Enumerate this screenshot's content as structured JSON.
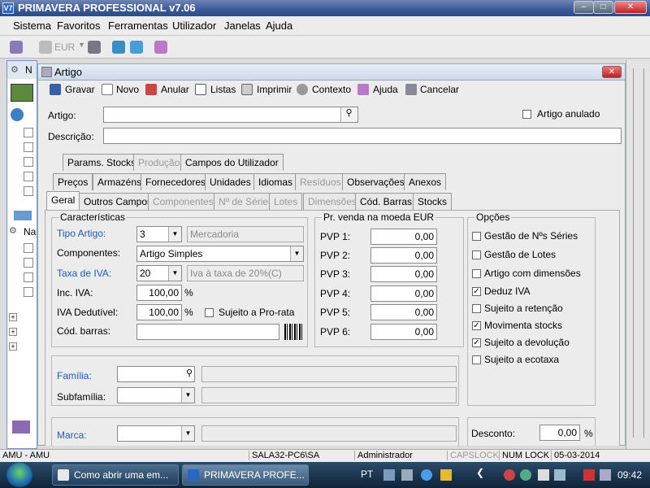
{
  "app": {
    "title": "PRIMAVERA PROFESSIONAL v7.06",
    "logo": "V7"
  },
  "menu": [
    "Sistema",
    "Favoritos",
    "Ferramentas",
    "Utilizador",
    "Janelas",
    "Ajuda"
  ],
  "toolbar": {
    "currency": "EUR"
  },
  "leftpane": {
    "item1": "N",
    "item2": "Na"
  },
  "window": {
    "title": "Artigo",
    "actions": [
      "Gravar",
      "Novo",
      "Anular",
      "Listas",
      "Imprimir",
      "Contexto",
      "Ajuda",
      "Cancelar"
    ],
    "artigo_label": "Artigo:",
    "descricao_label": "Descrição:",
    "artigo_anulado": "Artigo anulado",
    "tabs_row1": [
      "Params. Stocks",
      "Produção",
      "Campos do Utilizador"
    ],
    "tabs_row2": [
      "Preços",
      "Armazéns",
      "Fornecedores",
      "Unidades",
      "Idiomas",
      "Resíduos",
      "Observações",
      "Anexos"
    ],
    "tabs_row3": [
      "Geral",
      "Outros Campos",
      "Componentes",
      "Nº de Série",
      "Lotes",
      "Dimensões",
      "Cód. Barras",
      "Stocks"
    ],
    "caracteristicas": {
      "title": "Características",
      "tipo_label": "Tipo Artigo:",
      "tipo_value": "3",
      "tipo_desc": "Mercadoria",
      "componentes_label": "Componentes:",
      "componentes_value": "Artigo Simples",
      "iva_label": "Taxa de IVA:",
      "iva_value": "20",
      "iva_desc": "Iva à taxa de 20%(C)",
      "inc_iva_label": "Inc. IVA:",
      "inc_iva_value": "100,00",
      "pct": "%",
      "iva_ded_label": "IVA Dedutível:",
      "iva_ded_value": "100,00",
      "prorata_label": "Sujeito a Pro-rata",
      "codbarras_label": "Cód. barras:"
    },
    "pvp": {
      "title": "Pr. venda na moeda EUR",
      "rows": [
        {
          "label": "PVP 1:",
          "value": "0,00"
        },
        {
          "label": "PVP 2:",
          "value": "0,00"
        },
        {
          "label": "PVP 3:",
          "value": "0,00"
        },
        {
          "label": "PVP 4:",
          "value": "0,00"
        },
        {
          "label": "PVP 5:",
          "value": "0,00"
        },
        {
          "label": "PVP 6:",
          "value": "0,00"
        }
      ]
    },
    "opcoes": {
      "title": "Opções",
      "items": [
        {
          "label": "Gestão de Nºs Séries",
          "checked": false
        },
        {
          "label": "Gestão de Lotes",
          "checked": false
        },
        {
          "label": "Artigo com dimensões",
          "checked": false
        },
        {
          "label": "Deduz IVA",
          "checked": true
        },
        {
          "label": "Sujeito a retenção",
          "checked": false
        },
        {
          "label": "Movimenta stocks",
          "checked": true
        },
        {
          "label": "Sujeito a devolução",
          "checked": true
        },
        {
          "label": "Sujeito a ecotaxa",
          "checked": false
        }
      ]
    },
    "familia_label": "Família:",
    "subfamilia_label": "Subfamília:",
    "marca_label": "Marca:",
    "desconto_label": "Desconto:",
    "desconto_value": "0,00",
    "desconto_pct": "%"
  },
  "status": [
    "AMU - AMU",
    "SALA32-PC6\\SA",
    "Administrador",
    "CAPSLOCK",
    "NUM LOCK",
    "05-03-2014"
  ],
  "taskbar": {
    "buttons": [
      "Como abrir uma em...",
      "PRIMAVERA PROFE..."
    ],
    "lang": "PT",
    "clock": "09:42"
  }
}
